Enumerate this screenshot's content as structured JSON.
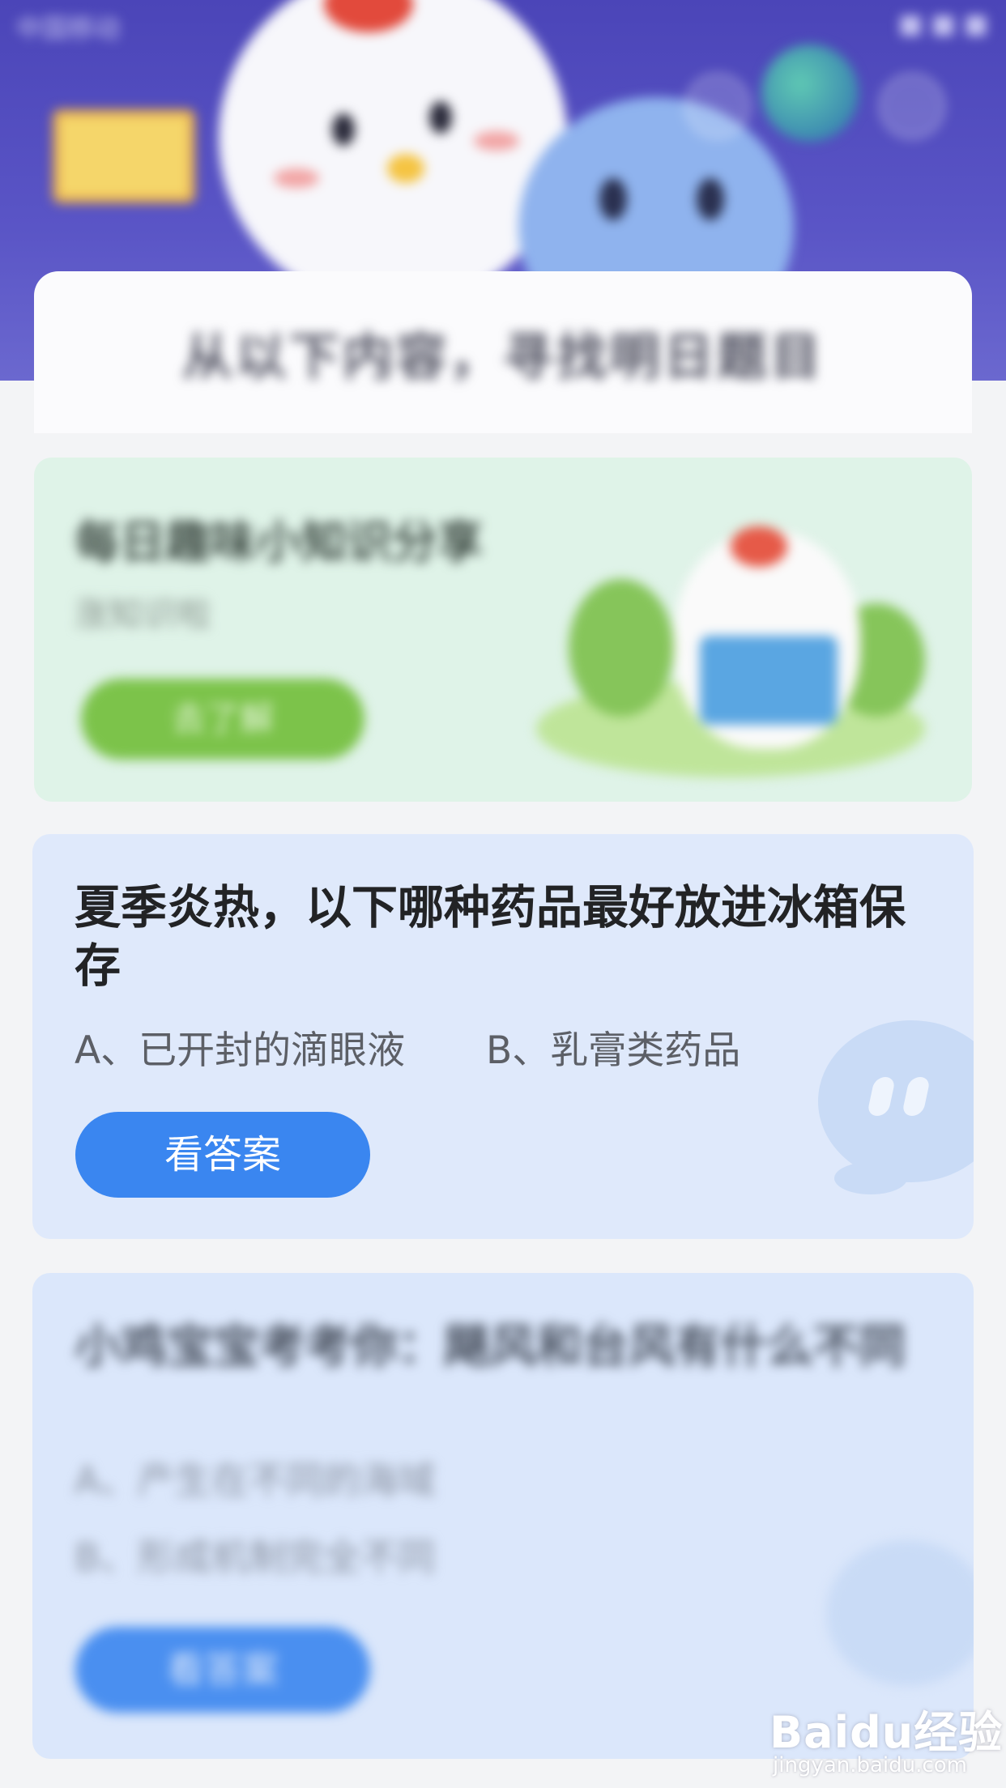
{
  "status_bar": {
    "carrier": "中国移动",
    "right_text": "■ ■ ■"
  },
  "header": {
    "title": "从以下内容，寻找明日题目",
    "share_icon": "share-icon",
    "settings_icon": "settings-icon"
  },
  "card_knowledge": {
    "title": "每日趣味小知识分享",
    "subtitle": "涨知识啦",
    "button_label": "去了解"
  },
  "card_question": {
    "question": "夏季炎热，以下哪种药品最好放进冰箱保存",
    "option_a": "A、已开封的滴眼液",
    "option_b": "B、乳膏类药品",
    "button_label": "看答案"
  },
  "card_question_2": {
    "question": "小鸡宝宝考考你：飓风和台风有什么不同",
    "option_a": "A、产生在不同的海域",
    "option_b": "B、形成机制完全不同",
    "button_label": "看答案"
  },
  "watermark": {
    "brand": "Baidu经验",
    "url": "jingyan.baidu.com"
  },
  "colors": {
    "accent_blue": "#3a86f0",
    "green_button": "#7cc34a",
    "header_purple": "#4b45b8"
  }
}
